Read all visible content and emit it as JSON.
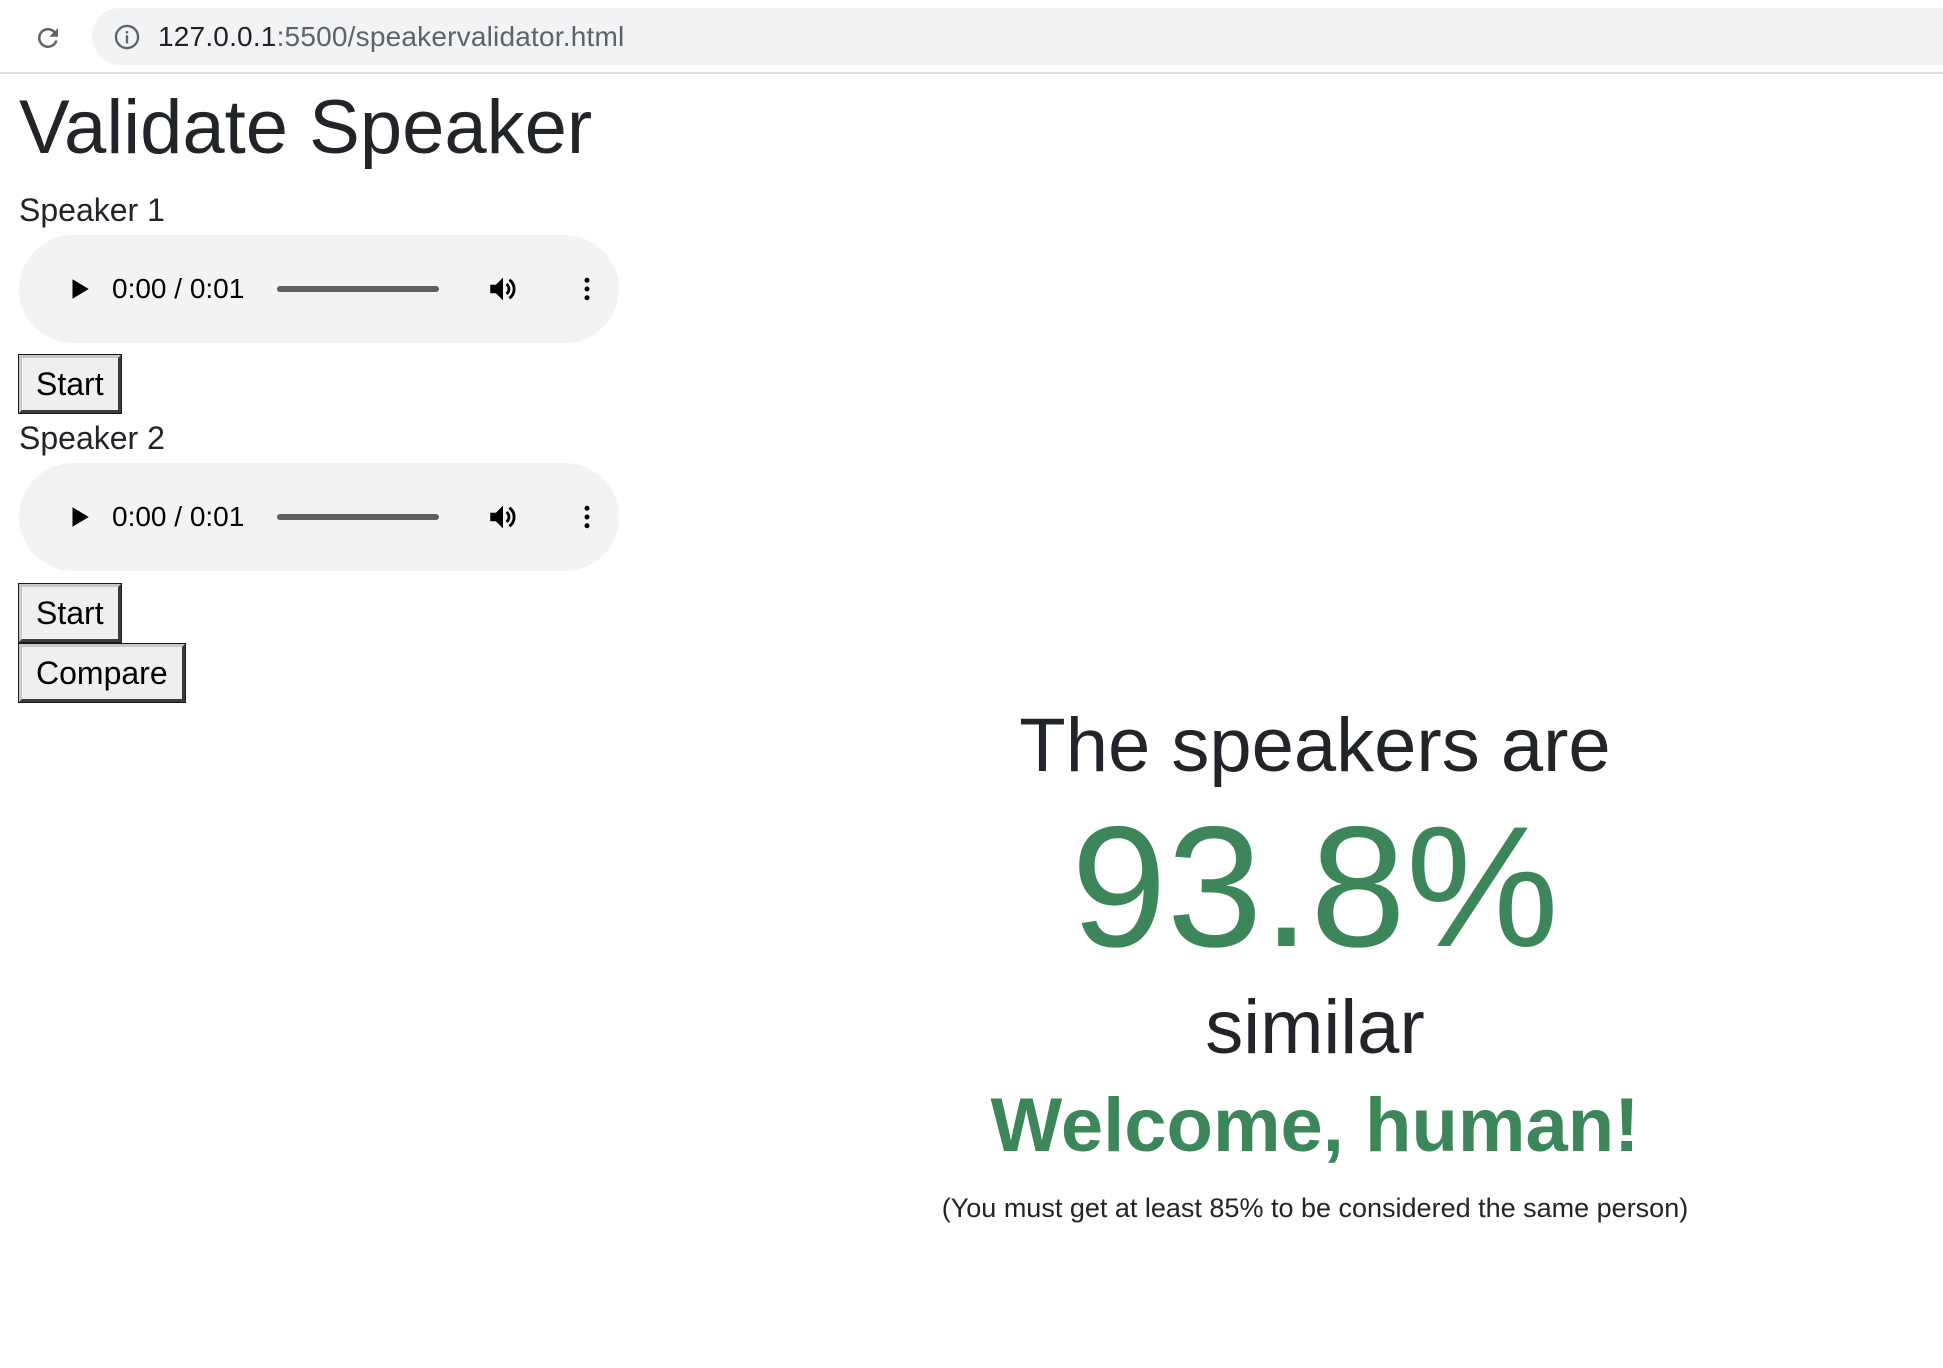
{
  "browser": {
    "url_host": "127.0.0.1",
    "url_path": ":5500/speakervalidator.html"
  },
  "page": {
    "title": "Validate Speaker"
  },
  "speakers": [
    {
      "label": "Speaker 1",
      "player": {
        "time": "0:00 / 0:01"
      },
      "start_label": "Start"
    },
    {
      "label": "Speaker 2",
      "player": {
        "time": "0:00 / 0:01"
      },
      "start_label": "Start"
    }
  ],
  "compare_label": "Compare",
  "result": {
    "lead": "The speakers are",
    "score": "93.8%",
    "similar": "similar",
    "verdict": "Welcome, human!",
    "note": "(You must get at least 85% to be considered the same person)",
    "accent_color": "#3c8659"
  },
  "icons": {
    "reload": "reload-icon",
    "info": "info-icon",
    "play": "play-icon",
    "volume": "volume-icon",
    "more": "more-vertical-icon"
  }
}
